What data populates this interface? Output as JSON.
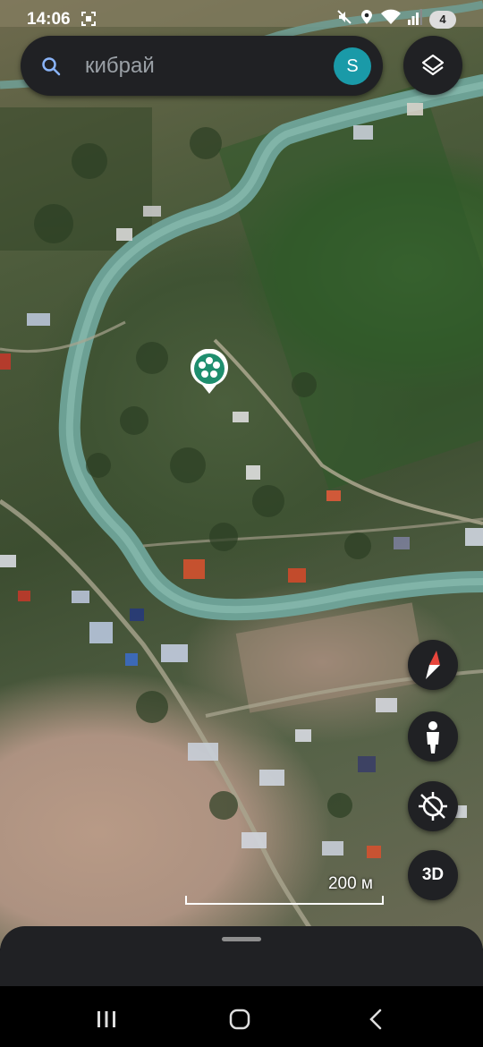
{
  "status_bar": {
    "time": "14:06",
    "battery_level": "4",
    "icons": [
      "screenshot-icon",
      "mute-icon",
      "location-icon",
      "wifi-icon",
      "signal-icon",
      "battery-icon"
    ]
  },
  "search": {
    "query": "кибрай",
    "avatar_letter": "S"
  },
  "map": {
    "scale_label": "200 м",
    "controls": {
      "three_d_label": "3D"
    }
  },
  "colors": {
    "panel": "#202124",
    "avatar": "#1a9aa8",
    "marker": "#1e8e6e",
    "compass_red": "#e8453c"
  }
}
